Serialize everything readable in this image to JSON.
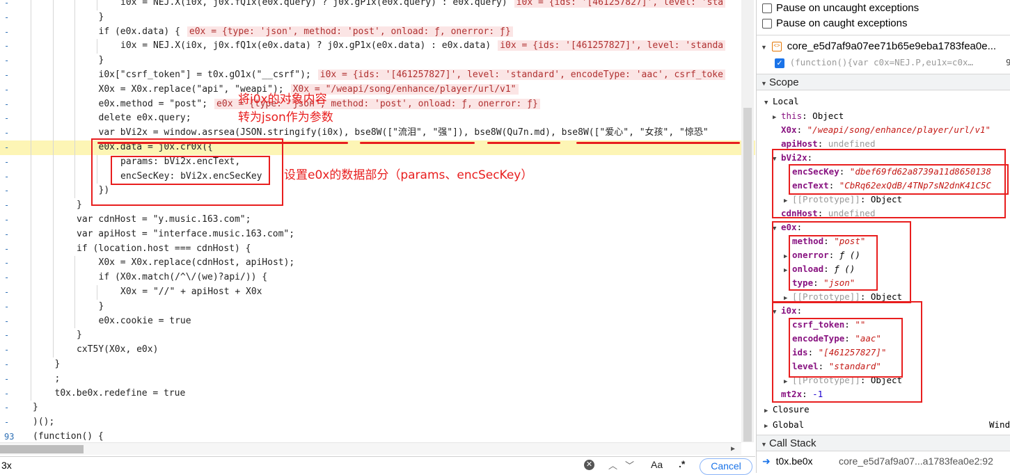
{
  "editor": {
    "lines": [
      {
        "num": "-",
        "indent": 5,
        "code": "i0x = NEJ.X(i0x, j0x.fQ1x(e0x.query) ? j0x.gP1x(e0x.query) : e0x.query)",
        "ann": "i0x = {ids: '[461257827]', level: 'sta"
      },
      {
        "num": "-",
        "indent": 4,
        "code": "}",
        "ann": ""
      },
      {
        "num": "-",
        "indent": 4,
        "code": "if (e0x.data) {",
        "ann": "e0x = {type: 'json', method: 'post', onload: ƒ, onerror: ƒ}"
      },
      {
        "num": "-",
        "indent": 5,
        "code": "i0x = NEJ.X(i0x, j0x.fQ1x(e0x.data) ? j0x.gP1x(e0x.data) : e0x.data)",
        "ann": "i0x = {ids: '[461257827]', level: 'standa"
      },
      {
        "num": "-",
        "indent": 4,
        "code": "}",
        "ann": ""
      },
      {
        "num": "-",
        "indent": 4,
        "code": "i0x[\"csrf_token\"] = t0x.gO1x(\"__csrf\");",
        "ann": "i0x = {ids: '[461257827]', level: 'standard', encodeType: 'aac', csrf_toke"
      },
      {
        "num": "-",
        "indent": 4,
        "code": "X0x = X0x.replace(\"api\", \"weapi\");",
        "ann": "X0x = \"/weapi/song/enhance/player/url/v1\""
      },
      {
        "num": "-",
        "indent": 4,
        "code": "e0x.method = \"post\";",
        "ann": "e0x = {type: 'json', method: 'post', onload: ƒ, onerror: ƒ}"
      },
      {
        "num": "-",
        "indent": 4,
        "code": "delete e0x.query;",
        "ann": ""
      },
      {
        "num": "-",
        "indent": 4,
        "code": "var bVi2x = window.asrsea(JSON.stringify(i0x), bse8W([\"流泪\", \"强\"]), bse8W(Qu7n.md), bse8W([\"爱心\", \"女孩\", \"惊恐\"",
        "ann": ""
      },
      {
        "num": "-",
        "indent": 4,
        "code": "e0x.data = j0x.cr0x({",
        "ann": ""
      },
      {
        "num": "-",
        "indent": 5,
        "code": "params: bVi2x.encText,",
        "ann": ""
      },
      {
        "num": "-",
        "indent": 5,
        "code": "encSecKey: bVi2x.encSecKey",
        "ann": ""
      },
      {
        "num": "-",
        "indent": 4,
        "code": "})",
        "ann": ""
      },
      {
        "num": "-",
        "indent": 3,
        "code": "}",
        "ann": ""
      },
      {
        "num": "-",
        "indent": 3,
        "code": "var cdnHost = \"y.music.163.com\";",
        "ann": ""
      },
      {
        "num": "-",
        "indent": 3,
        "code": "var apiHost = \"interface.music.163.com\";",
        "ann": ""
      },
      {
        "num": "-",
        "indent": 3,
        "code": "if (location.host === cdnHost) {",
        "ann": ""
      },
      {
        "num": "-",
        "indent": 4,
        "code": "X0x = X0x.replace(cdnHost, apiHost);",
        "ann": ""
      },
      {
        "num": "-",
        "indent": 4,
        "code": "if (X0x.match(/^\\/(we)?api/)) {",
        "ann": ""
      },
      {
        "num": "-",
        "indent": 5,
        "code": "X0x = \"//\" + apiHost + X0x",
        "ann": ""
      },
      {
        "num": "-",
        "indent": 4,
        "code": "}",
        "ann": ""
      },
      {
        "num": "-",
        "indent": 4,
        "code": "e0x.cookie = true",
        "ann": ""
      },
      {
        "num": "-",
        "indent": 3,
        "code": "}",
        "ann": ""
      },
      {
        "num": "-",
        "indent": 3,
        "code": "cxT5Y(X0x, e0x)",
        "ann": ""
      },
      {
        "num": "-",
        "indent": 2,
        "code": "}",
        "ann": ""
      },
      {
        "num": "-",
        "indent": 2,
        "code": ";",
        "ann": ""
      },
      {
        "num": "-",
        "indent": 2,
        "code": "t0x.be0x.redefine = true",
        "ann": ""
      },
      {
        "num": "-",
        "indent": 1,
        "code": "}",
        "ann": ""
      },
      {
        "num": "-",
        "indent": 1,
        "code": ")();",
        "ann": ""
      },
      {
        "num": "93",
        "indent": 1,
        "code": "(function() {",
        "ann": ""
      }
    ],
    "highlight_line": 10
  },
  "annotations": {
    "note1_line1": "将i0x的对象内容",
    "note1_line2": "转为json作为参数",
    "note2": "设置e0x的数据部分（params、encSecKey）"
  },
  "search": {
    "query": "3x",
    "case_label": "Aa",
    "regex_label": ".*",
    "cancel_label": "Cancel"
  },
  "debugger": {
    "pause_uncaught": "Pause on uncaught exceptions",
    "pause_caught": "Pause on caught exceptions",
    "breakpoint_file": "core_e5d7af9a07ee71b65e9eba1783fea0e...",
    "breakpoint_code": "(function(){var c0x=NEJ.P,eu1x=c0x…",
    "breakpoint_num": "9",
    "scope_title": "Scope",
    "local_label": "Local",
    "this_key": "this",
    "this_val": "Object",
    "x0x_key": "X0x",
    "x0x_val": "\"/weapi/song/enhance/player/url/v1\"",
    "apihost_key": "apiHost",
    "undef": "undefined",
    "bvi_key": "bVi2x",
    "encseckey_key": "encSecKey",
    "encseckey_val": "\"dbef69fd62a8739a11d8650138",
    "enctext_key": "encText",
    "enctext_val": "\"CbRq62exQdB/4TNp7sN2dnK41C5C",
    "proto": "[[Prototype]]",
    "obj": "Object",
    "cdnhost_key": "cdnHost",
    "e0x_key": "e0x",
    "method_key": "method",
    "method_val": "\"post\"",
    "onerror_key": "onerror",
    "onload_key": "onload",
    "fn_val": "ƒ ()",
    "type_key": "type",
    "type_val": "\"json\"",
    "i0x_key": "i0x",
    "csrf_key": "csrf_token",
    "csrf_val": "\"\"",
    "encodetype_key": "encodeType",
    "encodetype_val": "\"aac\"",
    "ids_key": "ids",
    "ids_val": "\"[461257827]\"",
    "level_key": "level",
    "level_val": "\"standard\"",
    "mt2x_key": "mt2x",
    "mt2x_val": "-1",
    "closure_label": "Closure",
    "global_label": "Global",
    "global_val": "Wind",
    "callstack_title": "Call Stack",
    "cs_fn": "t0x.be0x",
    "cs_loc": "core_e5d7af9a07...a1783fea0e2:92"
  }
}
